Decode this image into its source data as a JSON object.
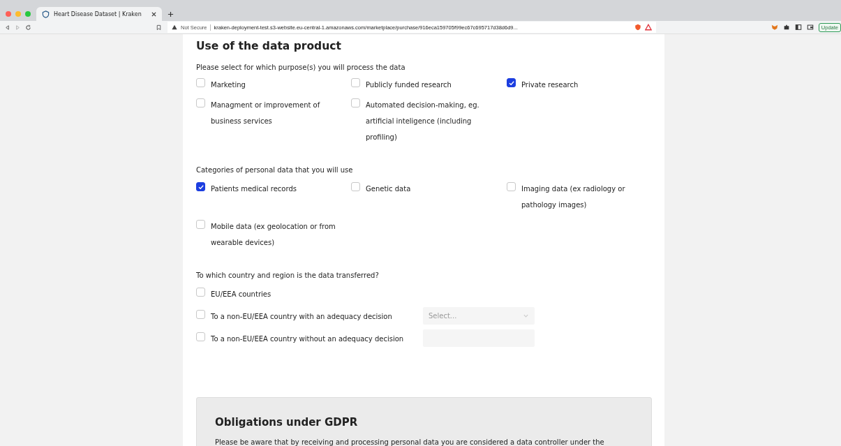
{
  "browser": {
    "tab_title": "Heart Disease Dataset | Kraken",
    "url_warning": "Not Secure",
    "url": "kraken-deployment-test.s3-website.eu-central-1.amazonaws.com/marketplace/purchase/916eca159705f99ec67c695717d38d6d9...",
    "update_button": "Update"
  },
  "form": {
    "title": "Use of the data product",
    "sections": [
      {
        "kind": "grid",
        "label": "Please select for which purpose(s) you will process the data",
        "options": [
          {
            "label": "Marketing",
            "checked": false
          },
          {
            "label": "Publicly funded research",
            "checked": false
          },
          {
            "label": "Private research",
            "checked": true
          },
          {
            "label": "Managment or improvement of business services",
            "checked": false
          },
          {
            "label": "Automated decision-making, eg. artificial inteligence (including profiling)",
            "checked": false
          }
        ]
      },
      {
        "kind": "grid",
        "label": "Categories of personal data that you will use",
        "options": [
          {
            "label": "Patients medical records",
            "checked": true
          },
          {
            "label": "Genetic data",
            "checked": false
          },
          {
            "label": "Imaging data (ex radiology or pathology images)",
            "checked": false
          },
          {
            "label": "Mobile data (ex geolocation or from wearable devices)",
            "checked": false
          }
        ]
      },
      {
        "kind": "list",
        "label": "To which country and region is the data transferred?",
        "options": [
          {
            "label": "EU/EEA countries",
            "checked": false
          },
          {
            "label": "To a non-EU/EEA country with an adequacy decision",
            "checked": false,
            "field": {
              "kind": "select",
              "placeholder": "Select..."
            }
          },
          {
            "label": "To a non-EU/EEA country without an adequacy decision",
            "checked": false,
            "field": {
              "kind": "input"
            }
          }
        ]
      }
    ]
  },
  "gdpr": {
    "title": "Obligations under GDPR",
    "text": "Please be aware that by receiving and processing personal data you are considered a data controller under the"
  }
}
